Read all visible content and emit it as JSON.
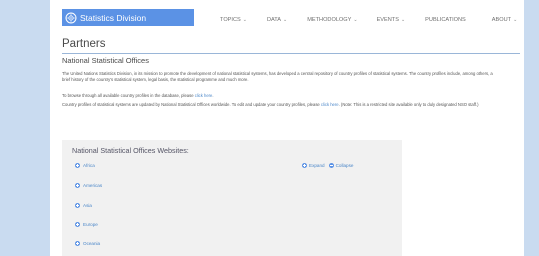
{
  "header": {
    "logo_text": "Statistics Division",
    "nav": [
      {
        "label": "TOPICS",
        "has_caret": true
      },
      {
        "label": "DATA",
        "has_caret": true
      },
      {
        "label": "METHODOLOGY",
        "has_caret": true
      },
      {
        "label": "EVENTS",
        "has_caret": true
      },
      {
        "label": "PUBLICATIONS",
        "has_caret": false
      },
      {
        "label": "ABOUT",
        "has_caret": true
      }
    ]
  },
  "page": {
    "title": "Partners",
    "subtitle": "National Statistical Offices",
    "intro": "The United Nations Statistics Division, in its mission to promote the development of national statistical systems, has developed a central repository of country profiles of statistical systems. The country profiles include, among others, a brief history of the country's statistical system, legal basis, the statistical programme and much more.",
    "browse_prefix": "To browse through all available country profiles in the database, please ",
    "browse_link": "click here",
    "browse_suffix": ".",
    "update_prefix": "Country profiles of statistical systems are updated by National Statistical Offices worldwide. To edit and update your country profiles, please ",
    "update_link": "click here",
    "update_suffix": ". (Note: This is a restricted site available only to duly designated NSO staff.)"
  },
  "panel": {
    "title": "National Statistical Offices Websites:",
    "expand_label": "Expand",
    "collapse_label": "Collapse",
    "regions": [
      "Africa",
      "Americas",
      "Asia",
      "Europe",
      "Oceania"
    ]
  },
  "colors": {
    "accent": "#5b92e5",
    "link": "#4a86c8",
    "background": "#c9dbf0"
  }
}
